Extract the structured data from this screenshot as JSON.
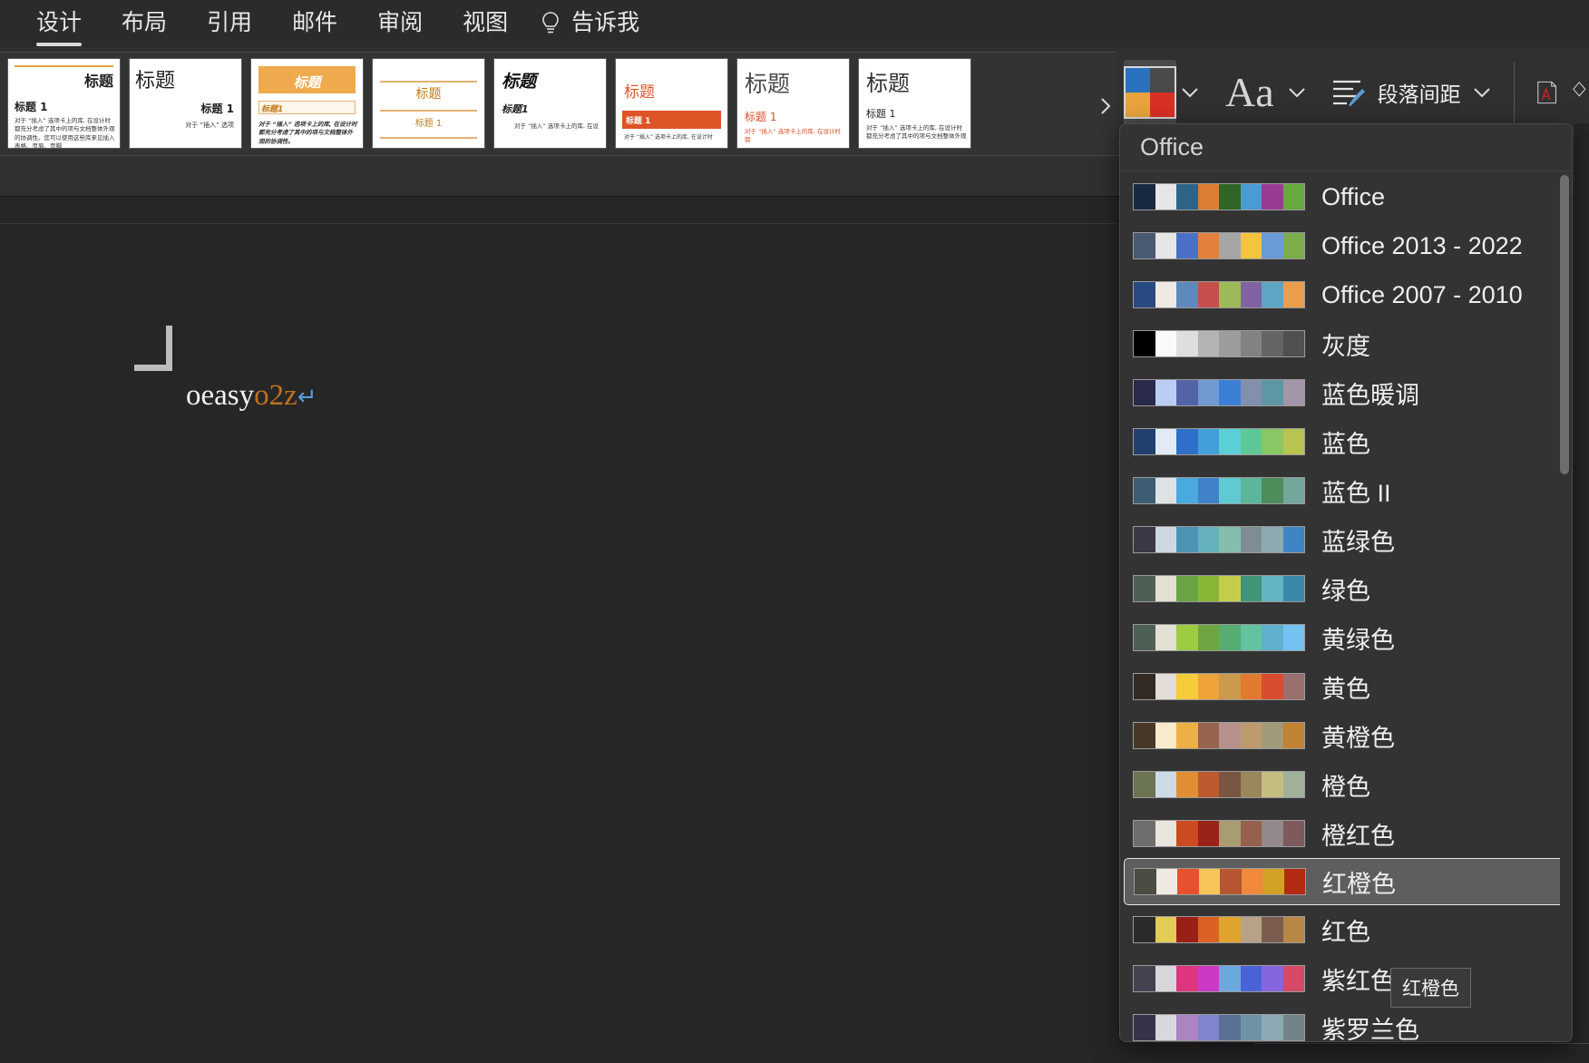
{
  "ribbon": {
    "tabs": [
      {
        "label": "设计",
        "active": true
      },
      {
        "label": "布局",
        "active": false
      },
      {
        "label": "引用",
        "active": false
      },
      {
        "label": "邮件",
        "active": false
      },
      {
        "label": "审阅",
        "active": false
      },
      {
        "label": "视图",
        "active": false
      }
    ],
    "tell_me": "告诉我",
    "bulb_icon": "lightbulb-icon"
  },
  "gallery": {
    "more_icon": "chevron-right-icon",
    "thumbs": [
      {
        "name": "theme-thumb-1",
        "title": "标题",
        "heading": "标题 1",
        "body": "对于 “插入” 选项卡上的库, 在设计时都充分考虑了其中的项与文档整体外观的协调性。您可以使用这些库来见插入表格、页眉、页脚"
      },
      {
        "name": "theme-thumb-2",
        "title": "标题",
        "heading": "标题 1",
        "body": "对于 “插入” 选项"
      },
      {
        "name": "theme-thumb-3",
        "title": "标题",
        "heading": "标题1",
        "body": "对于 “插入” 选项卡上的库, 在设计时都充分考虑了其中的项与文档整体外观的协调性。"
      },
      {
        "name": "theme-thumb-4",
        "title": "标题",
        "heading": "标题 1",
        "body": ""
      },
      {
        "name": "theme-thumb-5",
        "title": "标题",
        "heading": "标题1",
        "body": "对于 “插入” 选项卡上的库, 在设"
      },
      {
        "name": "theme-thumb-6",
        "title": "标题",
        "heading": "标题 1",
        "body": "对于 “插入” 选项卡上的库, 在设计时"
      },
      {
        "name": "theme-thumb-7",
        "title": "标题",
        "heading": "标题 1",
        "body": "对于 “插入” 选项卡上的库, 在设计时都"
      },
      {
        "name": "theme-thumb-8",
        "title": "标题",
        "heading": "标题 1",
        "body": "对于 “插入” 选项卡上的库, 在设计时都充分考虑了其中的项与文档整体外观"
      }
    ]
  },
  "document": {
    "text_plain": "oeasy",
    "text_accent": "o2z",
    "pilcrow": "↵",
    "corner_mark": "page-corner-mark"
  },
  "toolbar": {
    "colors_button": "colors-button",
    "colors_quad": [
      "#2a72c0",
      "#4a4a4a",
      "#e8a33d",
      "#d93025"
    ],
    "colors_chevron": "chevron-down-icon",
    "fonts_label": "Aa",
    "fonts_chevron": "chevron-down-icon",
    "paragraph_spacing_label": "段落间距",
    "paragraph_chevron": "chevron-down-icon",
    "watermark_icon": "watermark-page-icon",
    "page_color_icon": "page-color-icon"
  },
  "dropdown": {
    "header": "Office",
    "tooltip": "红橙色",
    "selected_index": 14,
    "rows": [
      {
        "label": "Office",
        "colors": [
          "#1a2942",
          "#e6e6e6",
          "#2f6389",
          "#dd7c33",
          "#2f6628",
          "#4a9bd5",
          "#9a3b93",
          "#67a83f"
        ]
      },
      {
        "label": "Office 2013 - 2022",
        "colors": [
          "#4b5a73",
          "#e6e6e6",
          "#4a71c5",
          "#e2803c",
          "#a6a6a6",
          "#f2c53c",
          "#6a9bd8",
          "#7cae4c"
        ]
      },
      {
        "label": "Office 2007 - 2010",
        "colors": [
          "#284a80",
          "#eeeae3",
          "#5e89bd",
          "#c44f4c",
          "#9cbb58",
          "#7f63a3",
          "#5da5c3",
          "#eb9d4e"
        ]
      },
      {
        "label": "灰度",
        "colors": [
          "#000000",
          "#fafafa",
          "#dedede",
          "#b4b4b4",
          "#9c9c9c",
          "#828282",
          "#646464",
          "#505050"
        ]
      },
      {
        "label": "蓝色暖调",
        "colors": [
          "#2a2a4d",
          "#bbcdf2",
          "#5263a8",
          "#6f9bd1",
          "#3c80d5",
          "#828fae",
          "#5e96a3",
          "#a296a8"
        ]
      },
      {
        "label": "蓝色",
        "colors": [
          "#23416e",
          "#e0ebf5",
          "#2e70c7",
          "#42a0d8",
          "#5ccfd6",
          "#5dc896",
          "#88c763",
          "#b7c44f"
        ]
      },
      {
        "label": "蓝色 II",
        "colors": [
          "#3d5d73",
          "#dee2e5",
          "#4aaae0",
          "#3f82c8",
          "#5fc9d4",
          "#5db59a",
          "#4e8c5b",
          "#74a69c"
        ]
      },
      {
        "label": "蓝绿色",
        "colors": [
          "#3a3847",
          "#ced8e2",
          "#4b93b5",
          "#65b1bd",
          "#84bdac",
          "#7d8d93",
          "#8fa9b3",
          "#3f85c4"
        ]
      },
      {
        "label": "绿色",
        "colors": [
          "#4d6055",
          "#e2dfd3",
          "#68a444",
          "#8ab636",
          "#c5cc49",
          "#3f9577",
          "#60b4c4",
          "#3b88ab"
        ]
      },
      {
        "label": "黄绿色",
        "colors": [
          "#4d6055",
          "#e2dfd3",
          "#9fcb43",
          "#6fa541",
          "#56ad72",
          "#62c3a1",
          "#5fb0cc",
          "#73c2f2"
        ]
      },
      {
        "label": "黄色",
        "colors": [
          "#332a23",
          "#e2ddd8",
          "#f5cc3a",
          "#eda33a",
          "#cc9a4c",
          "#e27a2e",
          "#d84b2c",
          "#99706d"
        ]
      },
      {
        "label": "黄橙色",
        "colors": [
          "#473829",
          "#f7ebcb",
          "#eeaf44",
          "#95634e",
          "#b6918b",
          "#bd9b6e",
          "#a19a78",
          "#c18234"
        ]
      },
      {
        "label": "橙色",
        "colors": [
          "#6b7453",
          "#ccdbe5",
          "#e08e34",
          "#bd5a2e",
          "#7a5642",
          "#9b855b",
          "#c4bd80",
          "#a0b099"
        ]
      },
      {
        "label": "橙红色",
        "colors": [
          "#6e6e6e",
          "#e8e5dc",
          "#cc4b21",
          "#992318",
          "#a99b72",
          "#96614c",
          "#91898a",
          "#7e5a5c"
        ]
      },
      {
        "label": "红橙色",
        "colors": [
          "#4b4c42",
          "#eeeae2",
          "#e8512f",
          "#f7c559",
          "#b55531",
          "#f0893c",
          "#d2a126",
          "#b12a11"
        ]
      },
      {
        "label": "红色",
        "colors": [
          "#2b2b2b",
          "#e2cc55",
          "#992014",
          "#da6222",
          "#e0a32e",
          "#b7a285",
          "#7b5d50",
          "#b78745"
        ]
      },
      {
        "label": "紫红色",
        "colors": [
          "#43424f",
          "#d8d8dc",
          "#dd3580",
          "#cc39c4",
          "#6aa8de",
          "#4a62d8",
          "#8666e0",
          "#d64a67"
        ]
      },
      {
        "label": "紫罗兰色",
        "colors": [
          "#35344a",
          "#d8d8dc",
          "#ab84c4",
          "#7e84ce",
          "#5a7095",
          "#6e93a6",
          "#8da9b3",
          "#728289"
        ]
      }
    ]
  }
}
